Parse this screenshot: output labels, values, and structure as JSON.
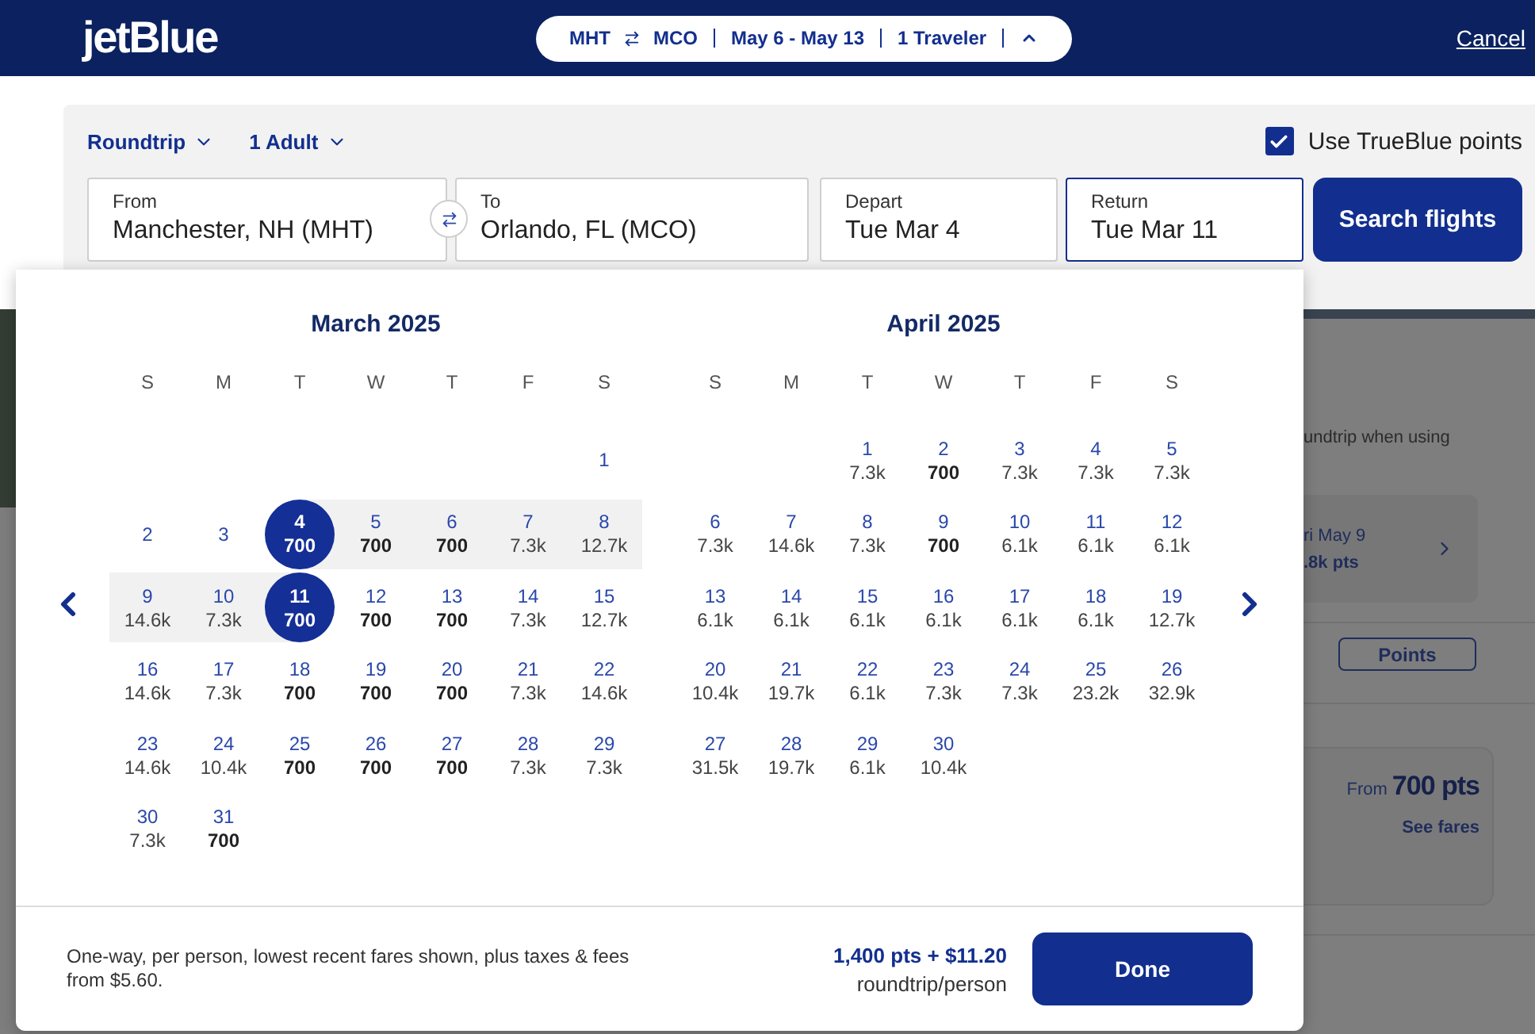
{
  "header": {
    "logo": "jetBlue",
    "summary": {
      "origin": "MHT",
      "destination": "MCO",
      "dates": "May 6 - May 13",
      "travelers": "1 Traveler",
      "expanded": true
    },
    "cancel": "Cancel"
  },
  "search": {
    "trip_type": "Roundtrip",
    "passengers": "1 Adult",
    "use_points": {
      "label": "Use TrueBlue points",
      "checked": true
    },
    "fields": [
      {
        "label": "From",
        "value": "Manchester, NH (MHT)",
        "selected": false
      },
      {
        "label": "To",
        "value": "Orlando, FL (MCO)",
        "selected": false
      },
      {
        "label": "Depart",
        "value": "Tue Mar 4",
        "selected": false
      },
      {
        "label": "Return",
        "value": "Tue Mar 11",
        "selected": true
      }
    ],
    "submit": "Search flights"
  },
  "calendar": {
    "months": [
      {
        "title": "March 2025",
        "weekdays": [
          "S",
          "M",
          "T",
          "W",
          "T",
          "F",
          "S"
        ],
        "weeks": [
          [
            {
              "day": "1",
              "selected": false,
              "in_range": false
            }
          ],
          [
            {
              "day": "2",
              "selected": false,
              "in_range": false
            },
            {
              "day": "3",
              "selected": false,
              "in_range": false
            },
            {
              "day": "4",
              "price": "700",
              "low": true,
              "selected": true,
              "in_range": false
            },
            {
              "day": "5",
              "price": "700",
              "low": true,
              "selected": false,
              "in_range": true
            },
            {
              "day": "6",
              "price": "700",
              "low": true,
              "selected": false,
              "in_range": true
            },
            {
              "day": "7",
              "price": "7.3k",
              "low": false,
              "selected": false,
              "in_range": true
            },
            {
              "day": "8",
              "price": "12.7k",
              "low": false,
              "selected": false,
              "in_range": true
            }
          ],
          [
            {
              "day": "9",
              "price": "14.6k",
              "low": false,
              "selected": false,
              "in_range": true
            },
            {
              "day": "10",
              "price": "7.3k",
              "low": false,
              "selected": false,
              "in_range": true
            },
            {
              "day": "11",
              "price": "700",
              "low": true,
              "selected": true,
              "in_range": false
            },
            {
              "day": "12",
              "price": "700",
              "low": true,
              "selected": false,
              "in_range": false
            },
            {
              "day": "13",
              "price": "700",
              "low": true,
              "selected": false,
              "in_range": false
            },
            {
              "day": "14",
              "price": "7.3k",
              "low": false,
              "selected": false,
              "in_range": false
            },
            {
              "day": "15",
              "price": "12.7k",
              "low": false,
              "selected": false,
              "in_range": false
            }
          ],
          [
            {
              "day": "16",
              "price": "14.6k",
              "low": false,
              "selected": false,
              "in_range": false
            },
            {
              "day": "17",
              "price": "7.3k",
              "low": false,
              "selected": false,
              "in_range": false
            },
            {
              "day": "18",
              "price": "700",
              "low": true,
              "selected": false,
              "in_range": false
            },
            {
              "day": "19",
              "price": "700",
              "low": true,
              "selected": false,
              "in_range": false
            },
            {
              "day": "20",
              "price": "700",
              "low": true,
              "selected": false,
              "in_range": false
            },
            {
              "day": "21",
              "price": "7.3k",
              "low": false,
              "selected": false,
              "in_range": false
            },
            {
              "day": "22",
              "price": "14.6k",
              "low": false,
              "selected": false,
              "in_range": false
            }
          ],
          [
            {
              "day": "23",
              "price": "14.6k",
              "low": false,
              "selected": false,
              "in_range": false
            },
            {
              "day": "24",
              "price": "10.4k",
              "low": false,
              "selected": false,
              "in_range": false
            },
            {
              "day": "25",
              "price": "700",
              "low": true,
              "selected": false,
              "in_range": false
            },
            {
              "day": "26",
              "price": "700",
              "low": true,
              "selected": false,
              "in_range": false
            },
            {
              "day": "27",
              "price": "700",
              "low": true,
              "selected": false,
              "in_range": false
            },
            {
              "day": "28",
              "price": "7.3k",
              "low": false,
              "selected": false,
              "in_range": false
            },
            {
              "day": "29",
              "price": "7.3k",
              "low": false,
              "selected": false,
              "in_range": false
            }
          ],
          [
            {
              "day": "30",
              "price": "7.3k",
              "low": false,
              "selected": false,
              "in_range": false
            },
            {
              "day": "31",
              "price": "700",
              "low": true,
              "selected": false,
              "in_range": false
            }
          ]
        ]
      },
      {
        "title": "April 2025",
        "weekdays": [
          "S",
          "M",
          "T",
          "W",
          "T",
          "F",
          "S"
        ],
        "weeks": [
          [
            {
              "day": "1",
              "price": "7.3k",
              "low": false,
              "selected": false,
              "in_range": false
            },
            {
              "day": "2",
              "price": "700",
              "low": true,
              "selected": false,
              "in_range": false
            },
            {
              "day": "3",
              "price": "7.3k",
              "low": false,
              "selected": false,
              "in_range": false
            },
            {
              "day": "4",
              "price": "7.3k",
              "low": false,
              "selected": false,
              "in_range": false
            },
            {
              "day": "5",
              "price": "7.3k",
              "low": false,
              "selected": false,
              "in_range": false
            }
          ],
          [
            {
              "day": "6",
              "price": "7.3k",
              "low": false,
              "selected": false,
              "in_range": false
            },
            {
              "day": "7",
              "price": "14.6k",
              "low": false,
              "selected": false,
              "in_range": false
            },
            {
              "day": "8",
              "price": "7.3k",
              "low": false,
              "selected": false,
              "in_range": false
            },
            {
              "day": "9",
              "price": "700",
              "low": true,
              "selected": false,
              "in_range": false
            },
            {
              "day": "10",
              "price": "6.1k",
              "low": false,
              "selected": false,
              "in_range": false
            },
            {
              "day": "11",
              "price": "6.1k",
              "low": false,
              "selected": false,
              "in_range": false
            },
            {
              "day": "12",
              "price": "6.1k",
              "low": false,
              "selected": false,
              "in_range": false
            }
          ],
          [
            {
              "day": "13",
              "price": "6.1k",
              "low": false,
              "selected": false,
              "in_range": false
            },
            {
              "day": "14",
              "price": "6.1k",
              "low": false,
              "selected": false,
              "in_range": false
            },
            {
              "day": "15",
              "price": "6.1k",
              "low": false,
              "selected": false,
              "in_range": false
            },
            {
              "day": "16",
              "price": "6.1k",
              "low": false,
              "selected": false,
              "in_range": false
            },
            {
              "day": "17",
              "price": "6.1k",
              "low": false,
              "selected": false,
              "in_range": false
            },
            {
              "day": "18",
              "price": "6.1k",
              "low": false,
              "selected": false,
              "in_range": false
            },
            {
              "day": "19",
              "price": "12.7k",
              "low": false,
              "selected": false,
              "in_range": false
            }
          ],
          [
            {
              "day": "20",
              "price": "10.4k",
              "low": false,
              "selected": false,
              "in_range": false
            },
            {
              "day": "21",
              "price": "19.7k",
              "low": false,
              "selected": false,
              "in_range": false
            },
            {
              "day": "22",
              "price": "6.1k",
              "low": false,
              "selected": false,
              "in_range": false
            },
            {
              "day": "23",
              "price": "7.3k",
              "low": false,
              "selected": false,
              "in_range": false
            },
            {
              "day": "24",
              "price": "7.3k",
              "low": false,
              "selected": false,
              "in_range": false
            },
            {
              "day": "25",
              "price": "23.2k",
              "low": false,
              "selected": false,
              "in_range": false
            },
            {
              "day": "26",
              "price": "32.9k",
              "low": false,
              "selected": false,
              "in_range": false
            }
          ],
          [
            {
              "day": "27",
              "price": "31.5k",
              "low": false,
              "selected": false,
              "in_range": false
            },
            {
              "day": "28",
              "price": "19.7k",
              "low": false,
              "selected": false,
              "in_range": false
            },
            {
              "day": "29",
              "price": "6.1k",
              "low": false,
              "selected": false,
              "in_range": false
            },
            {
              "day": "30",
              "price": "10.4k",
              "low": false,
              "selected": false,
              "in_range": false
            }
          ]
        ]
      }
    ],
    "footer": {
      "note": "One-way, per person, lowest recent fares shown, plus taxes & fees from $5.60.",
      "total": "1,400 pts + $11.20",
      "total_caption": "roundtrip/person",
      "done": "Done"
    }
  },
  "background": {
    "promo_text": "undtrip when using",
    "date_card": {
      "date": "ri May 9",
      "points": ".8k pts"
    },
    "toggle": "Points",
    "fare_card": {
      "from": "From",
      "price": "700 pts",
      "link": "See fares"
    }
  }
}
